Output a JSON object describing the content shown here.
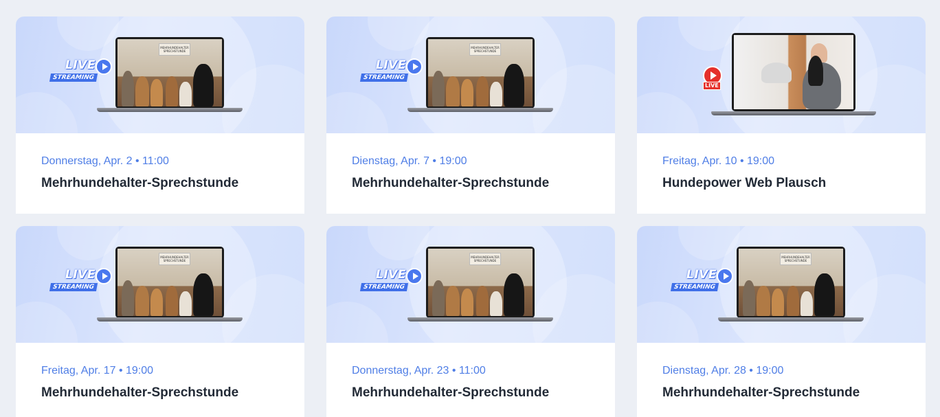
{
  "events": [
    {
      "date": "Donnerstag, Apr. 2 • 11:00",
      "title": "Mehrhundehalter-Sprechstunde",
      "thumbnail": "live-streaming-dogs"
    },
    {
      "date": "Dienstag, Apr. 7 • 19:00",
      "title": "Mehrhundehalter-Sprechstunde",
      "thumbnail": "live-streaming-dogs"
    },
    {
      "date": "Freitag, Apr. 10 • 19:00",
      "title": "Hundepower Web Plausch",
      "thumbnail": "live-webcam-person"
    },
    {
      "date": "Freitag, Apr. 17 • 19:00",
      "title": "Mehrhundehalter-Sprechstunde",
      "thumbnail": "live-streaming-dogs"
    },
    {
      "date": "Donnerstag, Apr. 23 • 11:00",
      "title": "Mehrhundehalter-Sprechstunde",
      "thumbnail": "live-streaming-dogs"
    },
    {
      "date": "Dienstag, Apr. 28 • 19:00",
      "title": "Mehrhundehalter-Sprechstunde",
      "thumbnail": "live-streaming-dogs"
    }
  ],
  "thumb_text": {
    "live": "LIVE",
    "streaming": "STREAMING",
    "sign": "MEHRHUNDEHALTER SPRECHSTUNDE",
    "yt_live": "LIVE"
  },
  "colors": {
    "date": "#4f7ee6",
    "title": "#222a36",
    "thumb_bg": "#cfdcfc",
    "page_bg": "#eceff5"
  }
}
